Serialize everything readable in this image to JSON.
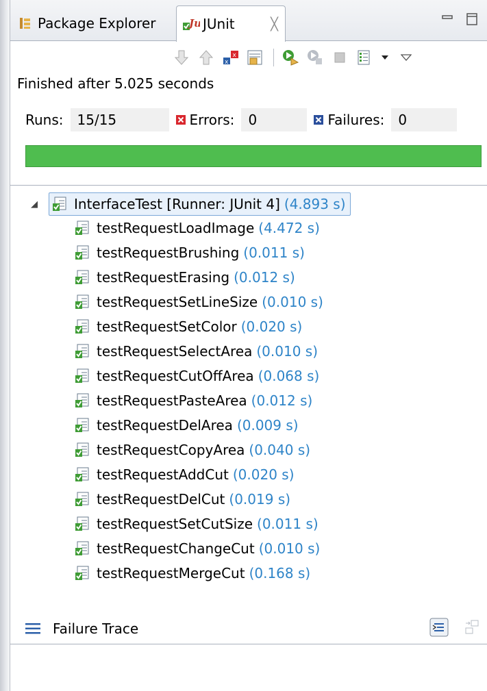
{
  "tabs": [
    {
      "label": "Package Explorer",
      "icon": "package-explorer-icon",
      "active": false
    },
    {
      "label": "JUnit",
      "icon": "junit-icon",
      "active": true,
      "close": "╳"
    }
  ],
  "status": "Finished after 5.025 seconds",
  "counters": {
    "runs_label": "Runs:",
    "runs_value": "15/15",
    "errors_label": "Errors:",
    "errors_value": "0",
    "failures_label": "Failures:",
    "failures_value": "0"
  },
  "progress": {
    "fraction": 1.0,
    "color": "#4fbd4f"
  },
  "tree": {
    "root": {
      "name": "InterfaceTest [Runner: JUnit 4]",
      "time": "(4.893 s)"
    },
    "tests": [
      {
        "name": "testRequestLoadImage",
        "time": "(4.472 s)"
      },
      {
        "name": "testRequestBrushing",
        "time": "(0.011 s)"
      },
      {
        "name": "testRequestErasing",
        "time": "(0.012 s)"
      },
      {
        "name": "testRequestSetLineSize",
        "time": "(0.010 s)"
      },
      {
        "name": "testRequestSetColor",
        "time": "(0.020 s)"
      },
      {
        "name": "testRequestSelectArea",
        "time": "(0.010 s)"
      },
      {
        "name": "testRequestCutOffArea",
        "time": "(0.068 s)"
      },
      {
        "name": "testRequestPasteArea",
        "time": "(0.012 s)"
      },
      {
        "name": "testRequestDelArea",
        "time": "(0.009 s)"
      },
      {
        "name": "testRequestCopyArea",
        "time": "(0.040 s)"
      },
      {
        "name": "testRequestAddCut",
        "time": "(0.020 s)"
      },
      {
        "name": "testRequestDelCut",
        "time": "(0.019 s)"
      },
      {
        "name": "testRequestSetCutSize",
        "time": "(0.011 s)"
      },
      {
        "name": "testRequestChangeCut",
        "time": "(0.010 s)"
      },
      {
        "name": "testRequestMergeCut",
        "time": "(0.168 s)"
      }
    ]
  },
  "failure_trace": {
    "label": "Failure Trace"
  }
}
